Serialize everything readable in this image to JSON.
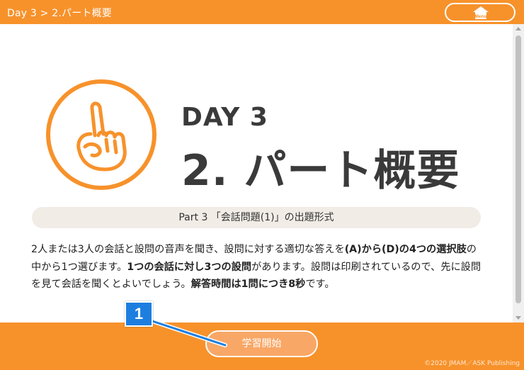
{
  "header": {
    "breadcrumb": "Day 3 > 2.パート概要",
    "menu_label": "Menu",
    "menu_icon": "house-icon"
  },
  "hero": {
    "icon": "pointing-hand-icon",
    "day_label": "DAY 3",
    "title": "2. パート概要"
  },
  "section": {
    "heading": "Part 3 「会話問題(1)」の出題形式"
  },
  "body": {
    "seg1": "2人または3人の会話と設問の音声を聞き、設問に対する適切な答えを",
    "seg2": "(A)から(D)の4つの選択肢",
    "seg3": "の中から1つ選びます。",
    "seg4": "1つの会話に対し3つの設問",
    "seg5": "があります。設問は印刷されているので、先に設問を見て会話を聞くとよいでしょう。",
    "seg6": "解答時間は1問につき8秒",
    "seg7": "です。"
  },
  "footer": {
    "start_label": "学習開始",
    "copyright": "©2020 JMAM／ASK Publishing"
  },
  "callout": {
    "number": "1"
  },
  "colors": {
    "accent": "#f7922b",
    "pill_bg": "#f1ece6",
    "callout": "#1e7ee0"
  }
}
